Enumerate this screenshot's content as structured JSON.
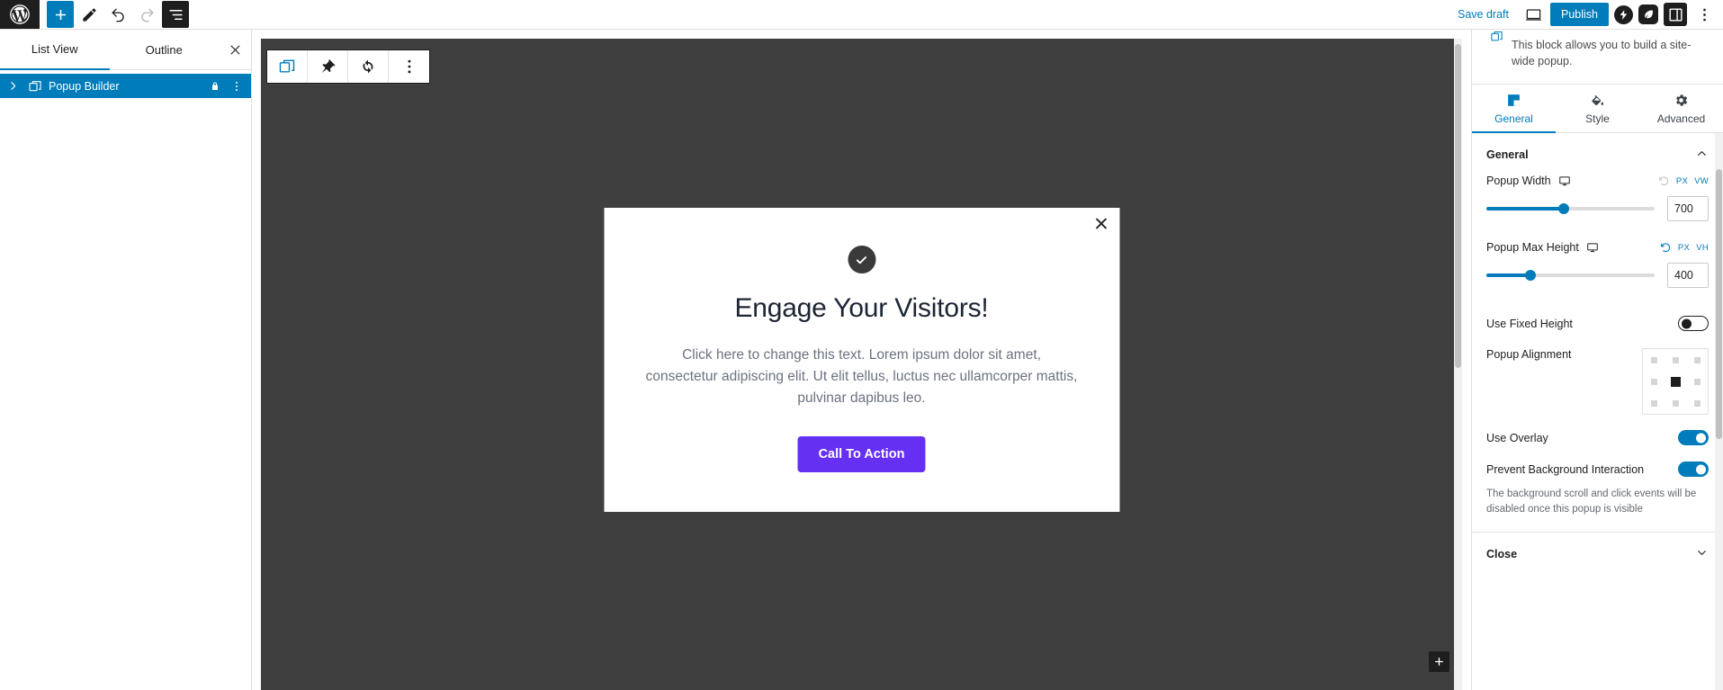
{
  "topbar": {
    "logo_icon": "wordpress-logo-icon",
    "add_block_icon": "plus-icon",
    "edit_icon": "pencil-icon",
    "undo_icon": "undo-arrow-icon",
    "redo_icon": "redo-arrow-icon",
    "list_view_icon": "list-view-icon",
    "save_draft_label": "Save draft",
    "preview_icon": "desktop-preview-icon",
    "publish_label": "Publish",
    "plugin_icon": "lightning-bolt-icon",
    "plugin2_icon": "leaf-badge-icon",
    "settings_panel_icon": "sidebar-panel-icon",
    "options_icon": "vertical-ellipsis-icon"
  },
  "listview": {
    "tabs": [
      {
        "label": "List View",
        "active": true
      },
      {
        "label": "Outline",
        "active": false
      }
    ],
    "close_icon": "close-icon",
    "items": [
      {
        "label": "Popup Builder",
        "expand_icon": "chevron-right-icon",
        "block_icon": "popup-block-icon",
        "lock_icon": "lock-icon",
        "more_icon": "vertical-ellipsis-icon",
        "selected": true
      }
    ]
  },
  "block_toolbar": {
    "buttons": [
      {
        "name": "block-type-button",
        "icon": "popup-block-icon",
        "selected": true
      },
      {
        "name": "pin-button",
        "icon": "pin-icon",
        "selected": false
      },
      {
        "name": "sync-button",
        "icon": "sync-refresh-icon",
        "selected": false
      },
      {
        "name": "more-options-button",
        "icon": "vertical-ellipsis-icon",
        "selected": false
      }
    ]
  },
  "canvas": {
    "background_color": "#3f3f3f",
    "popup": {
      "close_icon": "close-icon",
      "badge_icon": "check-circle-icon",
      "title": "Engage Your Visitors!",
      "body": "Click here to change this text. Lorem ipsum dolor sit amet, consectetur adipiscing elit. Ut elit tellus, luctus nec ullamcorper mattis, pulvinar dapibus leo.",
      "cta_label": "Call To Action",
      "cta_color": "#6630f2"
    },
    "add_block_icon": "plus-icon"
  },
  "settings": {
    "block_description": "This block allows you to build a site-wide popup.",
    "block_icon": "popup-block-icon",
    "tabs": [
      {
        "label": "General",
        "icon": "general-square-icon",
        "active": true
      },
      {
        "label": "Style",
        "icon": "paint-bucket-icon",
        "active": false
      },
      {
        "label": "Advanced",
        "icon": "gear-icon",
        "active": false
      }
    ],
    "sections": [
      {
        "label": "General",
        "expanded": true,
        "chevron_icon": "chevron-up-icon"
      },
      {
        "label": "Close",
        "expanded": false,
        "chevron_icon": "chevron-down-icon"
      }
    ],
    "controls": {
      "popup_width": {
        "label": "Popup Width",
        "device_icon": "desktop-icon",
        "reset_icon": "reset-icon",
        "reset_active": false,
        "units": [
          "PX",
          "VW"
        ],
        "value": "700",
        "slider_percent": 46
      },
      "popup_max_height": {
        "label": "Popup Max Height",
        "device_icon": "desktop-icon",
        "reset_icon": "reset-icon",
        "reset_active": true,
        "units": [
          "PX",
          "VH"
        ],
        "value": "400",
        "slider_percent": 26
      },
      "use_fixed_height": {
        "label": "Use Fixed Height",
        "on": false
      },
      "popup_alignment": {
        "label": "Popup Alignment",
        "selected_index": 4
      },
      "use_overlay": {
        "label": "Use Overlay",
        "on": true
      },
      "prevent_background_interaction": {
        "label": "Prevent Background Interaction",
        "on": true,
        "help": "The background scroll and click events will be disabled once this popup is visible"
      }
    }
  }
}
